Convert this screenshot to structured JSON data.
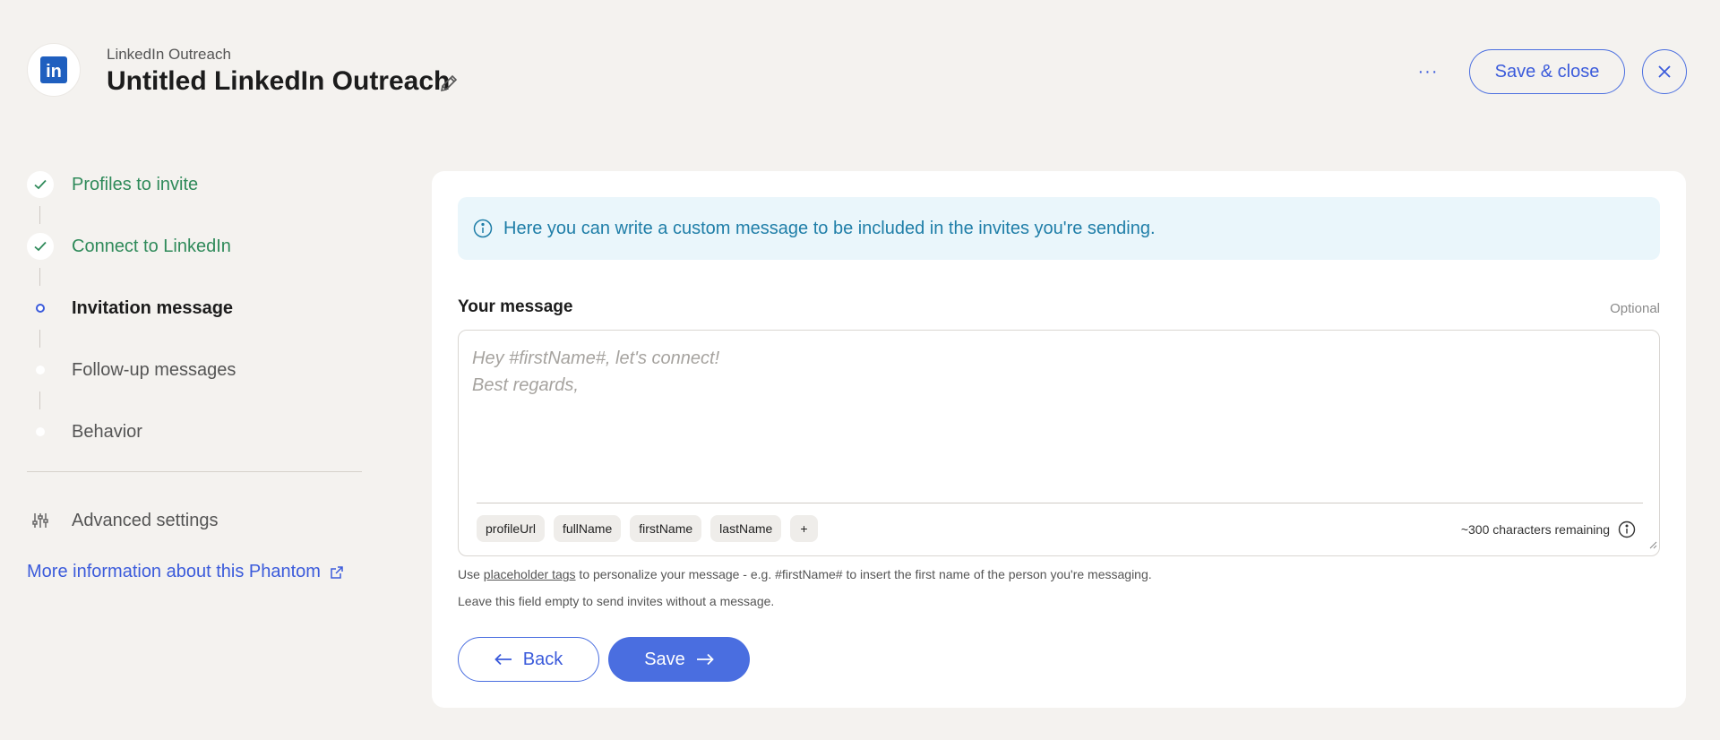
{
  "header": {
    "subtitle": "LinkedIn Outreach",
    "title": "Untitled LinkedIn Outreach",
    "more_label": "···",
    "save_close_label": "Save & close",
    "logo_text": "in"
  },
  "sidebar": {
    "steps": [
      {
        "label": "Profiles to invite",
        "state": "done"
      },
      {
        "label": "Connect to LinkedIn",
        "state": "done"
      },
      {
        "label": "Invitation message",
        "state": "active"
      },
      {
        "label": "Follow-up messages",
        "state": "pending"
      },
      {
        "label": "Behavior",
        "state": "pending"
      }
    ],
    "advanced_label": "Advanced settings",
    "more_info_label": "More information about this Phantom"
  },
  "main": {
    "info_text": "Here you can write a custom message to be included in the invites you're sending.",
    "field_label": "Your message",
    "optional_label": "Optional",
    "message_value": "",
    "message_placeholder": "Hey #firstName#, let's connect!\nBest regards,",
    "tags": [
      "profileUrl",
      "fullName",
      "firstName",
      "lastName",
      "+"
    ],
    "chars_remaining": "~300 characters remaining",
    "help_prefix": "Use ",
    "help_link": "placeholder tags",
    "help_suffix": " to personalize your message - e.g. #firstName# to insert the first name of the person you're messaging.",
    "help_2": "Leave this field empty to send invites without a message.",
    "back_label": "Back",
    "save_label": "Save"
  },
  "colors": {
    "accent": "#4a6ee0",
    "done_green": "#2f8a5a",
    "info_bg": "#eaf6fb",
    "info_text": "#1f7ea8",
    "page_bg": "#f4f2ef"
  },
  "icons": {
    "logo": "linkedin-logo-icon",
    "edit": "pencil-icon",
    "close": "close-icon",
    "check": "check-icon",
    "advanced": "sliders-icon",
    "external": "external-link-icon",
    "info": "info-circle-icon",
    "back": "arrow-left-icon",
    "save": "arrow-right-icon"
  }
}
